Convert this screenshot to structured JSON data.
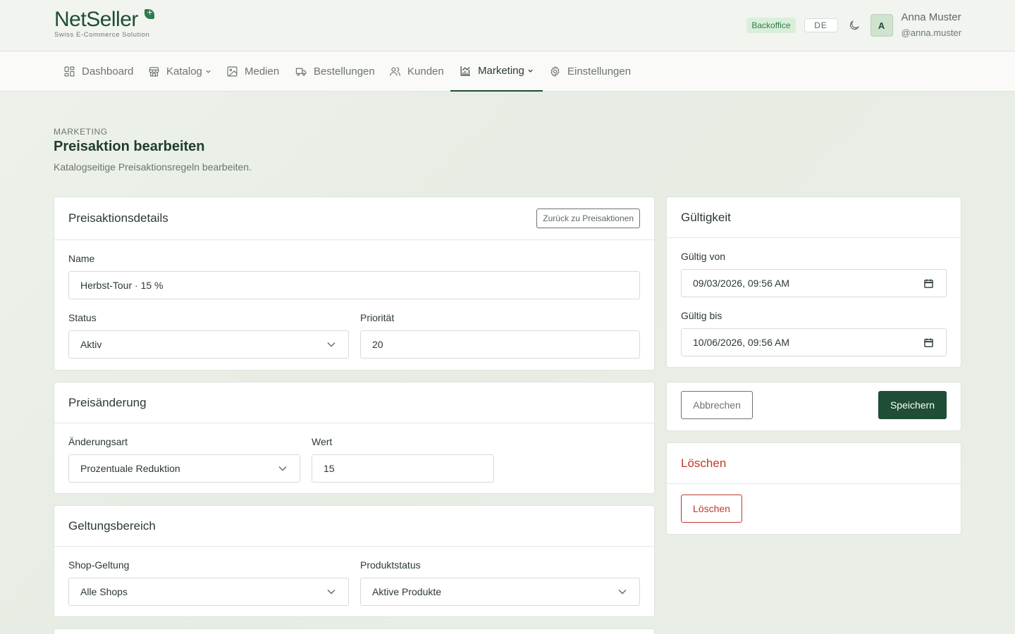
{
  "header": {
    "logo_text_left": "Net",
    "logo_text_right": "Seller",
    "logo_tagline": "Swiss E-Commerce Solution",
    "badge": "Backoffice",
    "language": "DE",
    "avatar_initial": "A",
    "user_name": "Anna Muster",
    "user_handle": "@anna.muster"
  },
  "nav": {
    "items": [
      {
        "label": "Dashboard",
        "icon": "dashboard-icon"
      },
      {
        "label": "Katalog",
        "icon": "store-icon",
        "has_dropdown": true
      },
      {
        "label": "Medien",
        "icon": "image-icon"
      },
      {
        "label": "Bestellungen",
        "icon": "truck-icon"
      },
      {
        "label": "Kunden",
        "icon": "users-icon"
      },
      {
        "label": "Marketing",
        "icon": "chart-icon",
        "has_dropdown": true,
        "active": true
      },
      {
        "label": "Einstellungen",
        "icon": "gear-icon"
      }
    ]
  },
  "page": {
    "eyebrow": "MARKETING",
    "title": "Preisaktion bearbeiten",
    "subtitle": "Katalogseitige Preisaktionsregeln bearbeiten."
  },
  "details": {
    "title": "Preisaktionsdetails",
    "back_button": "Zurück zu Preisaktionen",
    "name_label": "Name",
    "name_value": "Herbst-Tour · 15 %",
    "status_label": "Status",
    "status_value": "Aktiv",
    "priority_label": "Priorität",
    "priority_value": "20"
  },
  "price_change": {
    "title": "Preisänderung",
    "type_label": "Änderungsart",
    "type_value": "Prozentuale Reduktion",
    "value_label": "Wert",
    "value_value": "15"
  },
  "scope": {
    "title": "Geltungsbereich",
    "shop_label": "Shop-Geltung",
    "shop_value": "Alle Shops",
    "product_status_label": "Produktstatus",
    "product_status_value": "Aktive Produkte"
  },
  "validity": {
    "title": "Gültigkeit",
    "from_label": "Gültig von",
    "from_value": "09/03/2026, 09:56 AM",
    "to_label": "Gültig bis",
    "to_value": "10/06/2026, 09:56 AM"
  },
  "actions": {
    "cancel": "Abbrechen",
    "save": "Speichern"
  },
  "delete": {
    "title": "Löschen",
    "button": "Löschen"
  },
  "colors": {
    "brand": "#1f4d35",
    "danger": "#c0392b",
    "badge_bg": "#d9efda"
  }
}
